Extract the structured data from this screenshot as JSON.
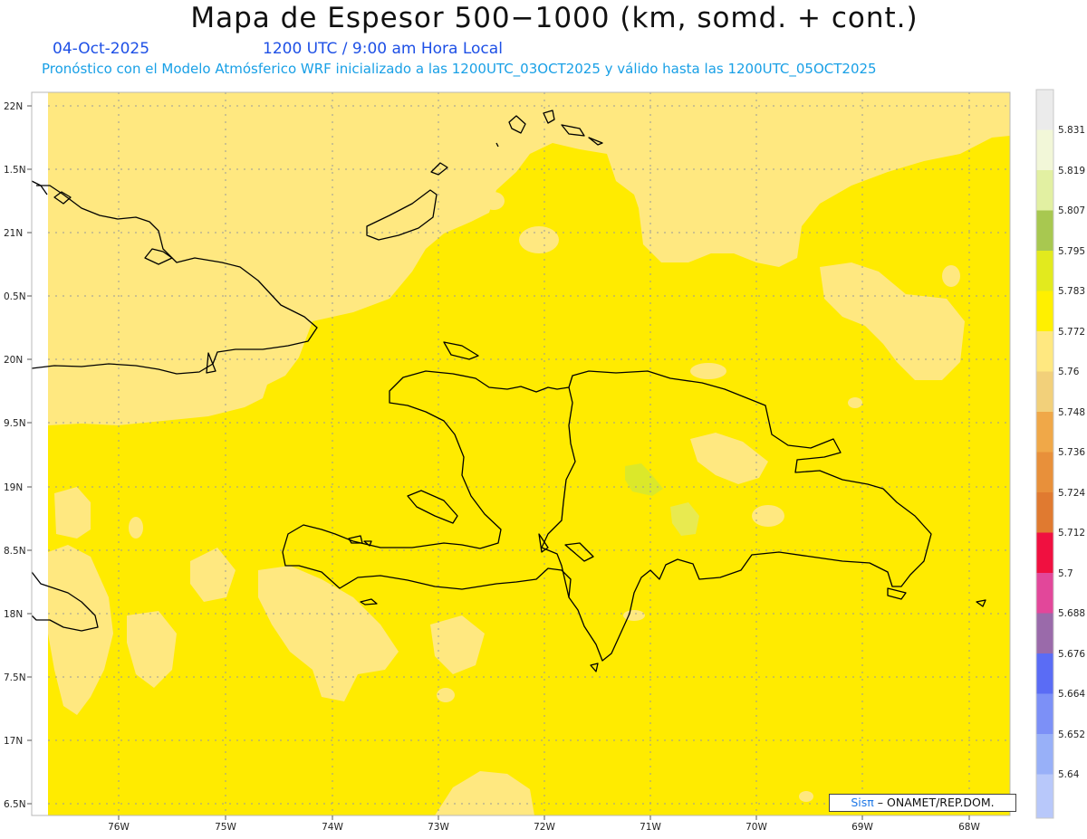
{
  "header": {
    "title": "Mapa de Espesor 500−1000 (km, somd. + cont.)",
    "date": "04-Oct-2025",
    "time": "1200 UTC / 9:00 am Hora Local",
    "forecast": "Pronóstico con el Modelo Atmósferico WRF inicializado a las 1200UTC_03OCT2025 y válido hasta las  1200UTC_05OCT2025"
  },
  "map": {
    "lat_labels": [
      "22N",
      "1.5N",
      "21N",
      "0.5N",
      "20N",
      "9.5N",
      "19N",
      "8.5N",
      "18N",
      "7.5N",
      "17N",
      "6.5N"
    ],
    "lon_labels": [
      "76W",
      "75W",
      "74W",
      "73W",
      "72W",
      "71W",
      "70W",
      "69W",
      "68W"
    ],
    "shading": {
      "background_level": "5.772",
      "background_color": "#ffeb00",
      "low_patch_level": "5.76",
      "low_patch_color": "#ffe880",
      "high_patch_level": "5.783",
      "high_patch_color": "#dbe82a"
    }
  },
  "colorbar": {
    "labels": [
      "5.831",
      "5.819",
      "5.807",
      "5.795",
      "5.783",
      "5.772",
      "5.76",
      "5.748",
      "5.736",
      "5.724",
      "5.712",
      "5.7",
      "5.688",
      "5.676",
      "5.664",
      "5.652",
      "5.64"
    ],
    "colors": [
      "#ebebeb",
      "#f2f7d8",
      "#e2f0a2",
      "#a8c850",
      "#e2ea1e",
      "#fff000",
      "#ffe880",
      "#f2d07a",
      "#f0a848",
      "#e8903a",
      "#e07a30",
      "#f01040",
      "#e2479a",
      "#9a6aaa",
      "#5a6cf5",
      "#7c90f7",
      "#98b0f8",
      "#b8c8fa"
    ]
  },
  "credit": {
    "logo": "Sisπ",
    "text": "ONAMET/REP.DOM."
  }
}
